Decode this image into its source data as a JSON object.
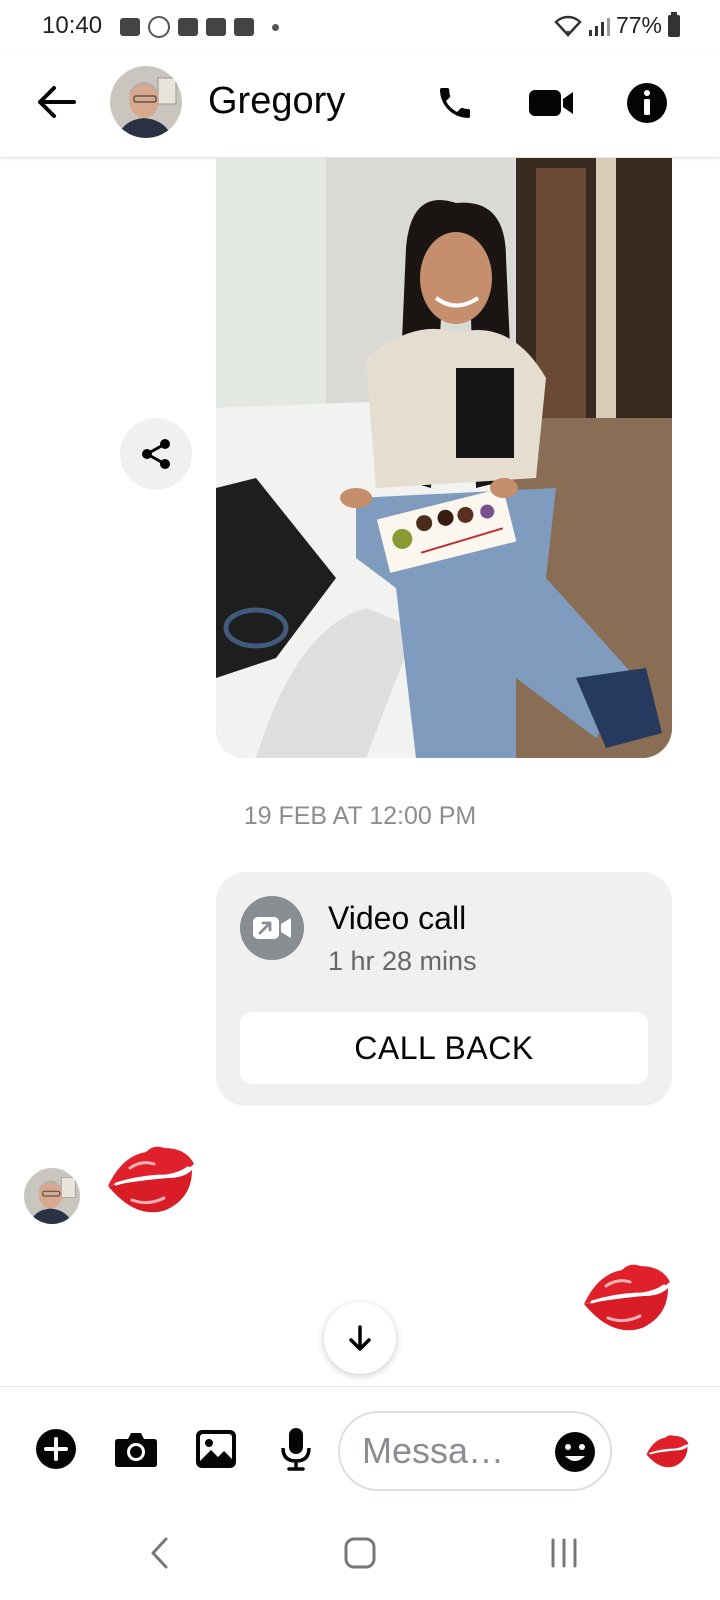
{
  "status_bar": {
    "time": "10:40",
    "battery": "77%"
  },
  "header": {
    "contact_name": "Gregory",
    "icons": [
      "back-arrow-icon",
      "phone-icon",
      "video-camera-icon",
      "info-icon"
    ]
  },
  "messages": {
    "timestamp": "19 FEB AT 12:00 PM",
    "video_call": {
      "title": "Video call",
      "duration": "1 hr 28 mins",
      "callback_label": "CALL BACK"
    }
  },
  "composer": {
    "placeholder": "Messa…"
  },
  "colors": {
    "kiss": "#e0202a",
    "card_bg": "#f0f0f0",
    "muted_text": "#8a8d91"
  }
}
